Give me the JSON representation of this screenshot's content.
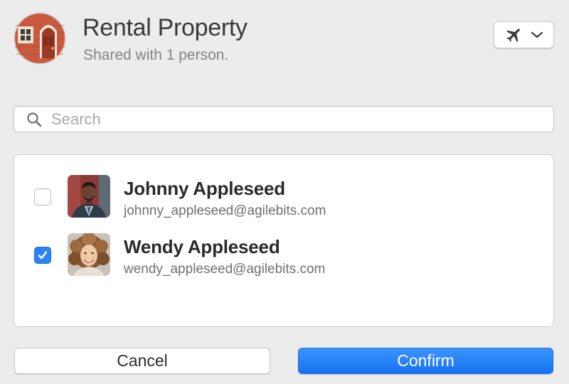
{
  "header": {
    "vault_icon": "house-icon",
    "title": "Rental Property",
    "subtitle": "Shared with 1 person.",
    "travel_button_icons": [
      "airplane-icon",
      "chevron-down-icon"
    ]
  },
  "search": {
    "placeholder": "Search",
    "value": "",
    "icon": "search-icon"
  },
  "people": [
    {
      "name": "Johnny Appleseed",
      "email": "johnny_appleseed@agilebits.com",
      "checked": false
    },
    {
      "name": "Wendy Appleseed",
      "email": "wendy_appleseed@agilebits.com",
      "checked": true
    }
  ],
  "actions": {
    "cancel_label": "Cancel",
    "confirm_label": "Confirm"
  },
  "colors": {
    "background": "#ececec",
    "accent": "#2e82f2",
    "confirm": "#1673f0"
  }
}
